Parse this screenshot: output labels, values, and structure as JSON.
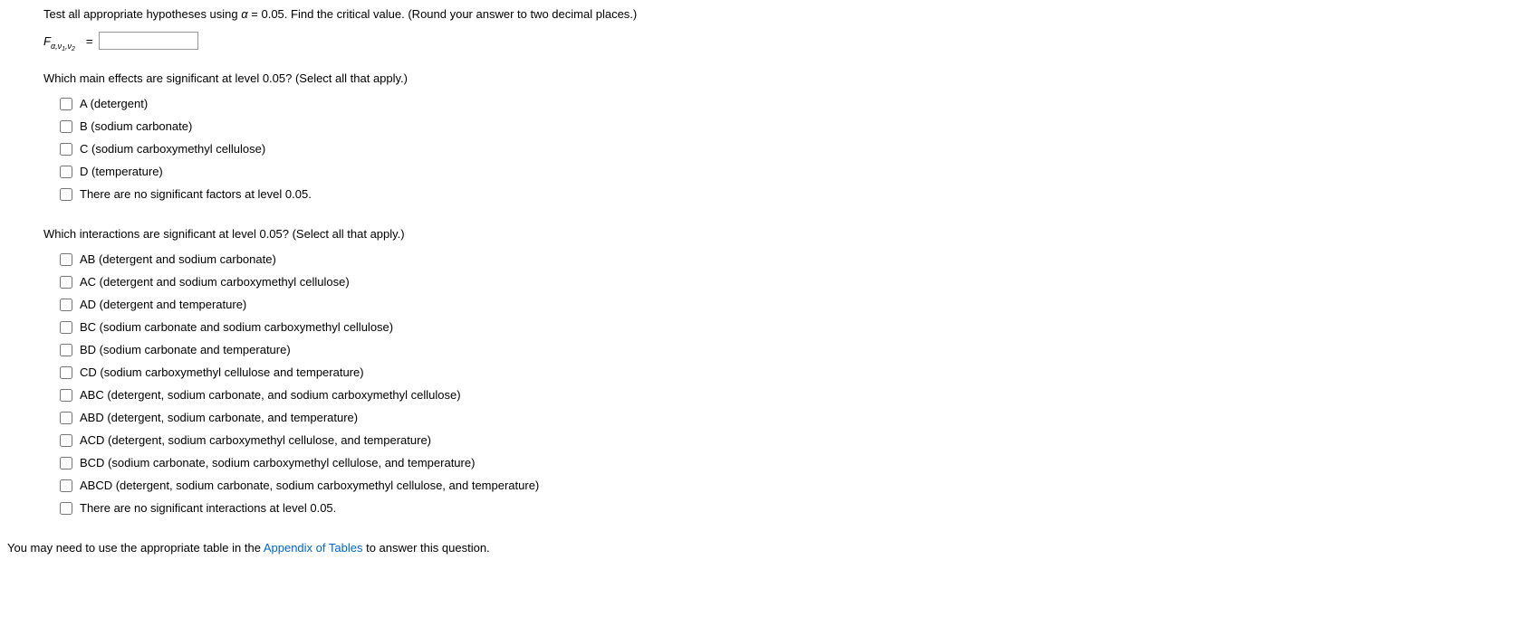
{
  "q1": {
    "prefix": "Test all appropriate hypotheses using ",
    "alpha_var": "α",
    "alpha_eq": " = 0.05. Find the critical value. (Round your answer to two decimal places.)"
  },
  "formula": {
    "main": "F",
    "sub_alpha": "α,",
    "sub_v": "ν",
    "sub_1": "1",
    "sub_comma": ",",
    "sub_2": "2",
    "equals": "="
  },
  "q2": {
    "text": "Which main effects are significant at level 0.05? (Select all that apply.)",
    "options": [
      "A (detergent)",
      "B (sodium carbonate)",
      "C (sodium carboxymethyl cellulose)",
      "D (temperature)",
      "There are no significant factors at level 0.05."
    ]
  },
  "q3": {
    "text": "Which interactions are significant at level 0.05? (Select all that apply.)",
    "options": [
      "AB (detergent and sodium carbonate)",
      "AC (detergent and sodium carboxymethyl cellulose)",
      "AD (detergent and temperature)",
      "BC (sodium carbonate and sodium carboxymethyl cellulose)",
      "BD (sodium carbonate and temperature)",
      "CD (sodium carboxymethyl cellulose and temperature)",
      "ABC (detergent, sodium carbonate, and sodium carboxymethyl cellulose)",
      "ABD (detergent, sodium carbonate, and temperature)",
      "ACD (detergent, sodium carboxymethyl cellulose, and temperature)",
      "BCD (sodium carbonate, sodium carboxymethyl cellulose, and temperature)",
      "ABCD (detergent, sodium carbonate, sodium carboxymethyl cellulose, and temperature)",
      "There are no significant interactions at level 0.05."
    ]
  },
  "footer": {
    "prefix": "You may need to use the appropriate table in the ",
    "link": "Appendix of Tables",
    "suffix": " to answer this question."
  }
}
